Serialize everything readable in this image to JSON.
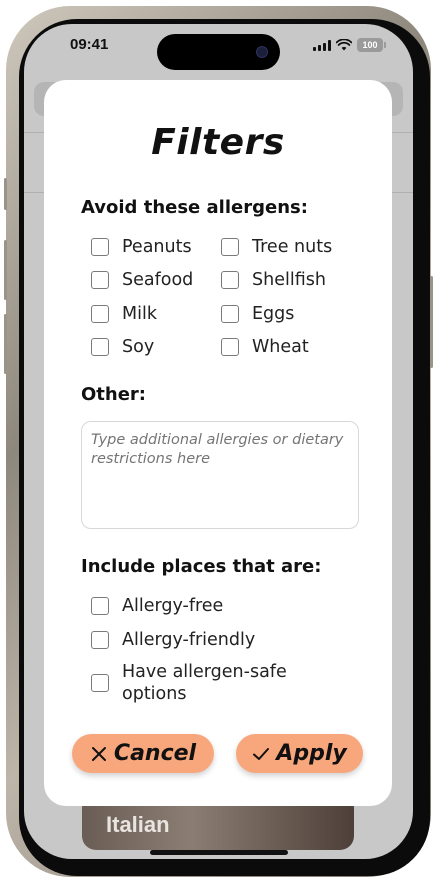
{
  "status_bar": {
    "time": "09:41",
    "battery": "100"
  },
  "background": {
    "card_label": "Italian"
  },
  "modal": {
    "title": "Filters",
    "allergens_heading": "Avoid these allergens:",
    "allergens": [
      {
        "label": "Peanuts",
        "checked": false
      },
      {
        "label": "Tree nuts",
        "checked": false
      },
      {
        "label": "Seafood",
        "checked": false
      },
      {
        "label": "Shellfish",
        "checked": false
      },
      {
        "label": "Milk",
        "checked": false
      },
      {
        "label": "Eggs",
        "checked": false
      },
      {
        "label": "Soy",
        "checked": false
      },
      {
        "label": "Wheat",
        "checked": false
      }
    ],
    "other_heading": "Other:",
    "other_placeholder": "Type additional allergies or dietary restrictions here",
    "places_heading": "Include places that are:",
    "places": [
      {
        "label": "Allergy-free",
        "checked": false
      },
      {
        "label": "Allergy-friendly",
        "checked": false
      },
      {
        "label": "Have allergen-safe options",
        "checked": false
      }
    ],
    "cancel_label": "Cancel",
    "apply_label": "Apply"
  },
  "colors": {
    "button": "#f8a77d",
    "overlay": "#c8c8c8",
    "frame": "#9a9388"
  },
  "icons": {
    "cancel": "close-icon",
    "apply": "checkmark-icon"
  }
}
